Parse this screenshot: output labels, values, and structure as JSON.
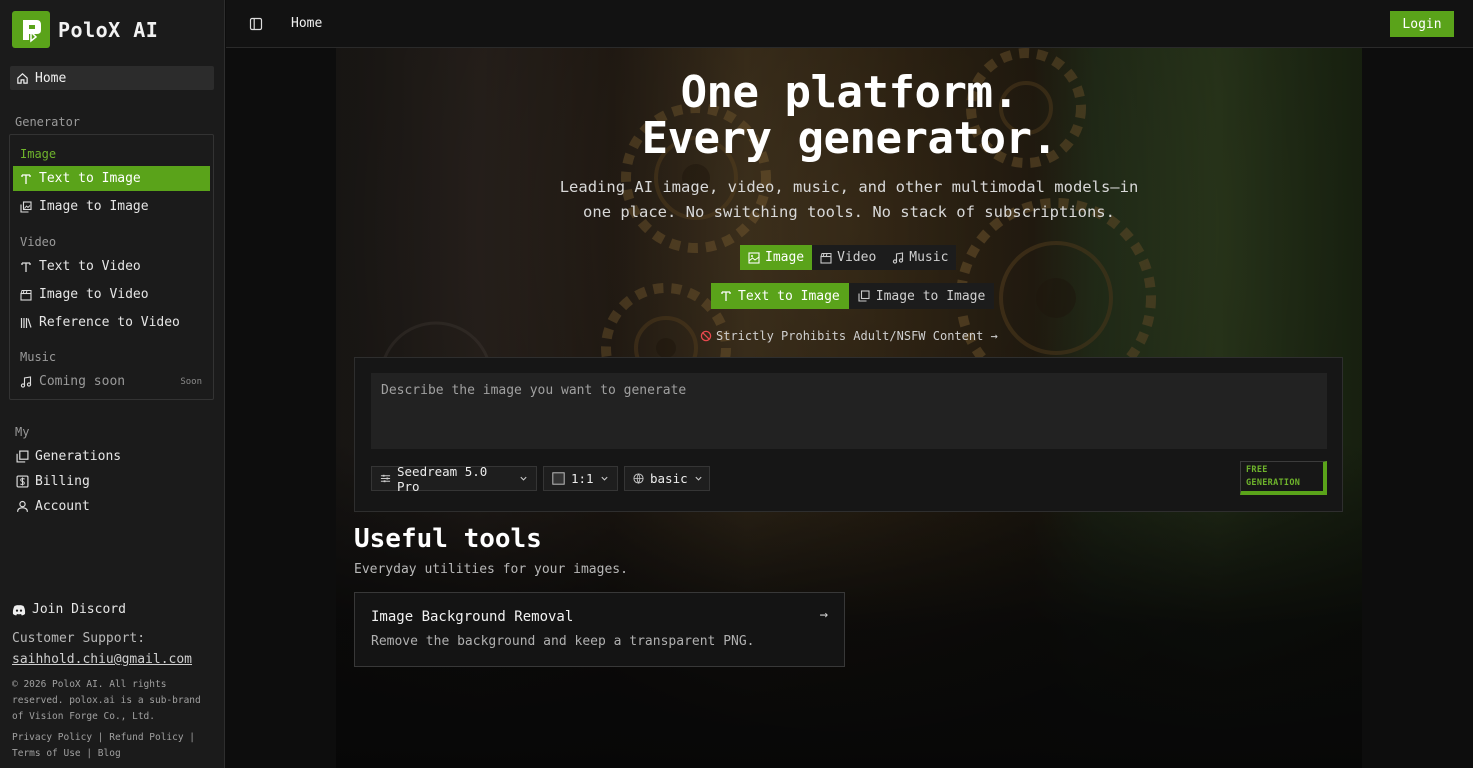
{
  "brand": {
    "name": "PoloX AI"
  },
  "colors": {
    "accent": "#5aa31a",
    "sidebar_bg": "#1b1b1b",
    "page_bg": "#0d0d0d"
  },
  "sidebar": {
    "home": {
      "label": "Home",
      "icon": "home-icon"
    },
    "generator_label": "Generator",
    "groups": {
      "image": {
        "label": "Image",
        "items": [
          {
            "label": "Text to Image",
            "icon": "text-icon",
            "active": true
          },
          {
            "label": "Image to Image",
            "icon": "images-icon",
            "active": false
          }
        ]
      },
      "video": {
        "label": "Video",
        "items": [
          {
            "label": "Text to Video",
            "icon": "text-icon"
          },
          {
            "label": "Image to Video",
            "icon": "clapperboard-icon"
          },
          {
            "label": "Reference to Video",
            "icon": "library-icon"
          }
        ]
      },
      "music": {
        "label": "Music",
        "items": [
          {
            "label": "Coming soon",
            "icon": "music-note-icon",
            "badge": "Soon"
          }
        ]
      }
    },
    "my_label": "My",
    "my_items": [
      {
        "label": "Generations",
        "icon": "images-icon"
      },
      {
        "label": "Billing",
        "icon": "dollar-icon"
      },
      {
        "label": "Account",
        "icon": "user-icon"
      }
    ],
    "discord": "Join Discord",
    "support_label": "Customer Support:",
    "support_email": "saihhold.chiu@gmail.com",
    "copyright": "© 2026 PoloX AI. All rights reserved. polox.ai is a sub-brand of Vision Forge Co., Ltd.",
    "footer_links": "Privacy Policy | Refund Policy | Terms of Use | Blog"
  },
  "topbar": {
    "breadcrumb": "Home",
    "login_label": "Login"
  },
  "hero": {
    "title_line1": "One platform.",
    "title_line2": "Every generator.",
    "subtitle": "Leading AI image, video, music, and other multimodal models—in one place. No switching tools. No stack of subscriptions.",
    "mode_tabs": [
      {
        "label": "Image",
        "icon": "image-icon",
        "active": true
      },
      {
        "label": "Video",
        "icon": "clapperboard-icon",
        "active": false
      },
      {
        "label": "Music",
        "icon": "music-note-icon",
        "active": false
      }
    ],
    "type_tabs": [
      {
        "label": "Text to Image",
        "icon": "text-icon",
        "active": true
      },
      {
        "label": "Image to Image",
        "icon": "images-icon",
        "active": false
      }
    ],
    "nsfw_notice": "Strictly Prohibits Adult/NSFW Content →"
  },
  "prompt": {
    "placeholder": "Describe the image you want to generate",
    "value": "",
    "model": "Seedream 5.0 Pro",
    "aspect": "1:1",
    "quality": "basic",
    "generate_line1": "FREE",
    "generate_line2": "GENERATION"
  },
  "tools": {
    "title": "Useful tools",
    "subtitle": "Everyday utilities for your images.",
    "cards": [
      {
        "title": "Image Background Removal",
        "description": "Remove the background and keep a transparent PNG.",
        "arrow": "→"
      }
    ]
  }
}
